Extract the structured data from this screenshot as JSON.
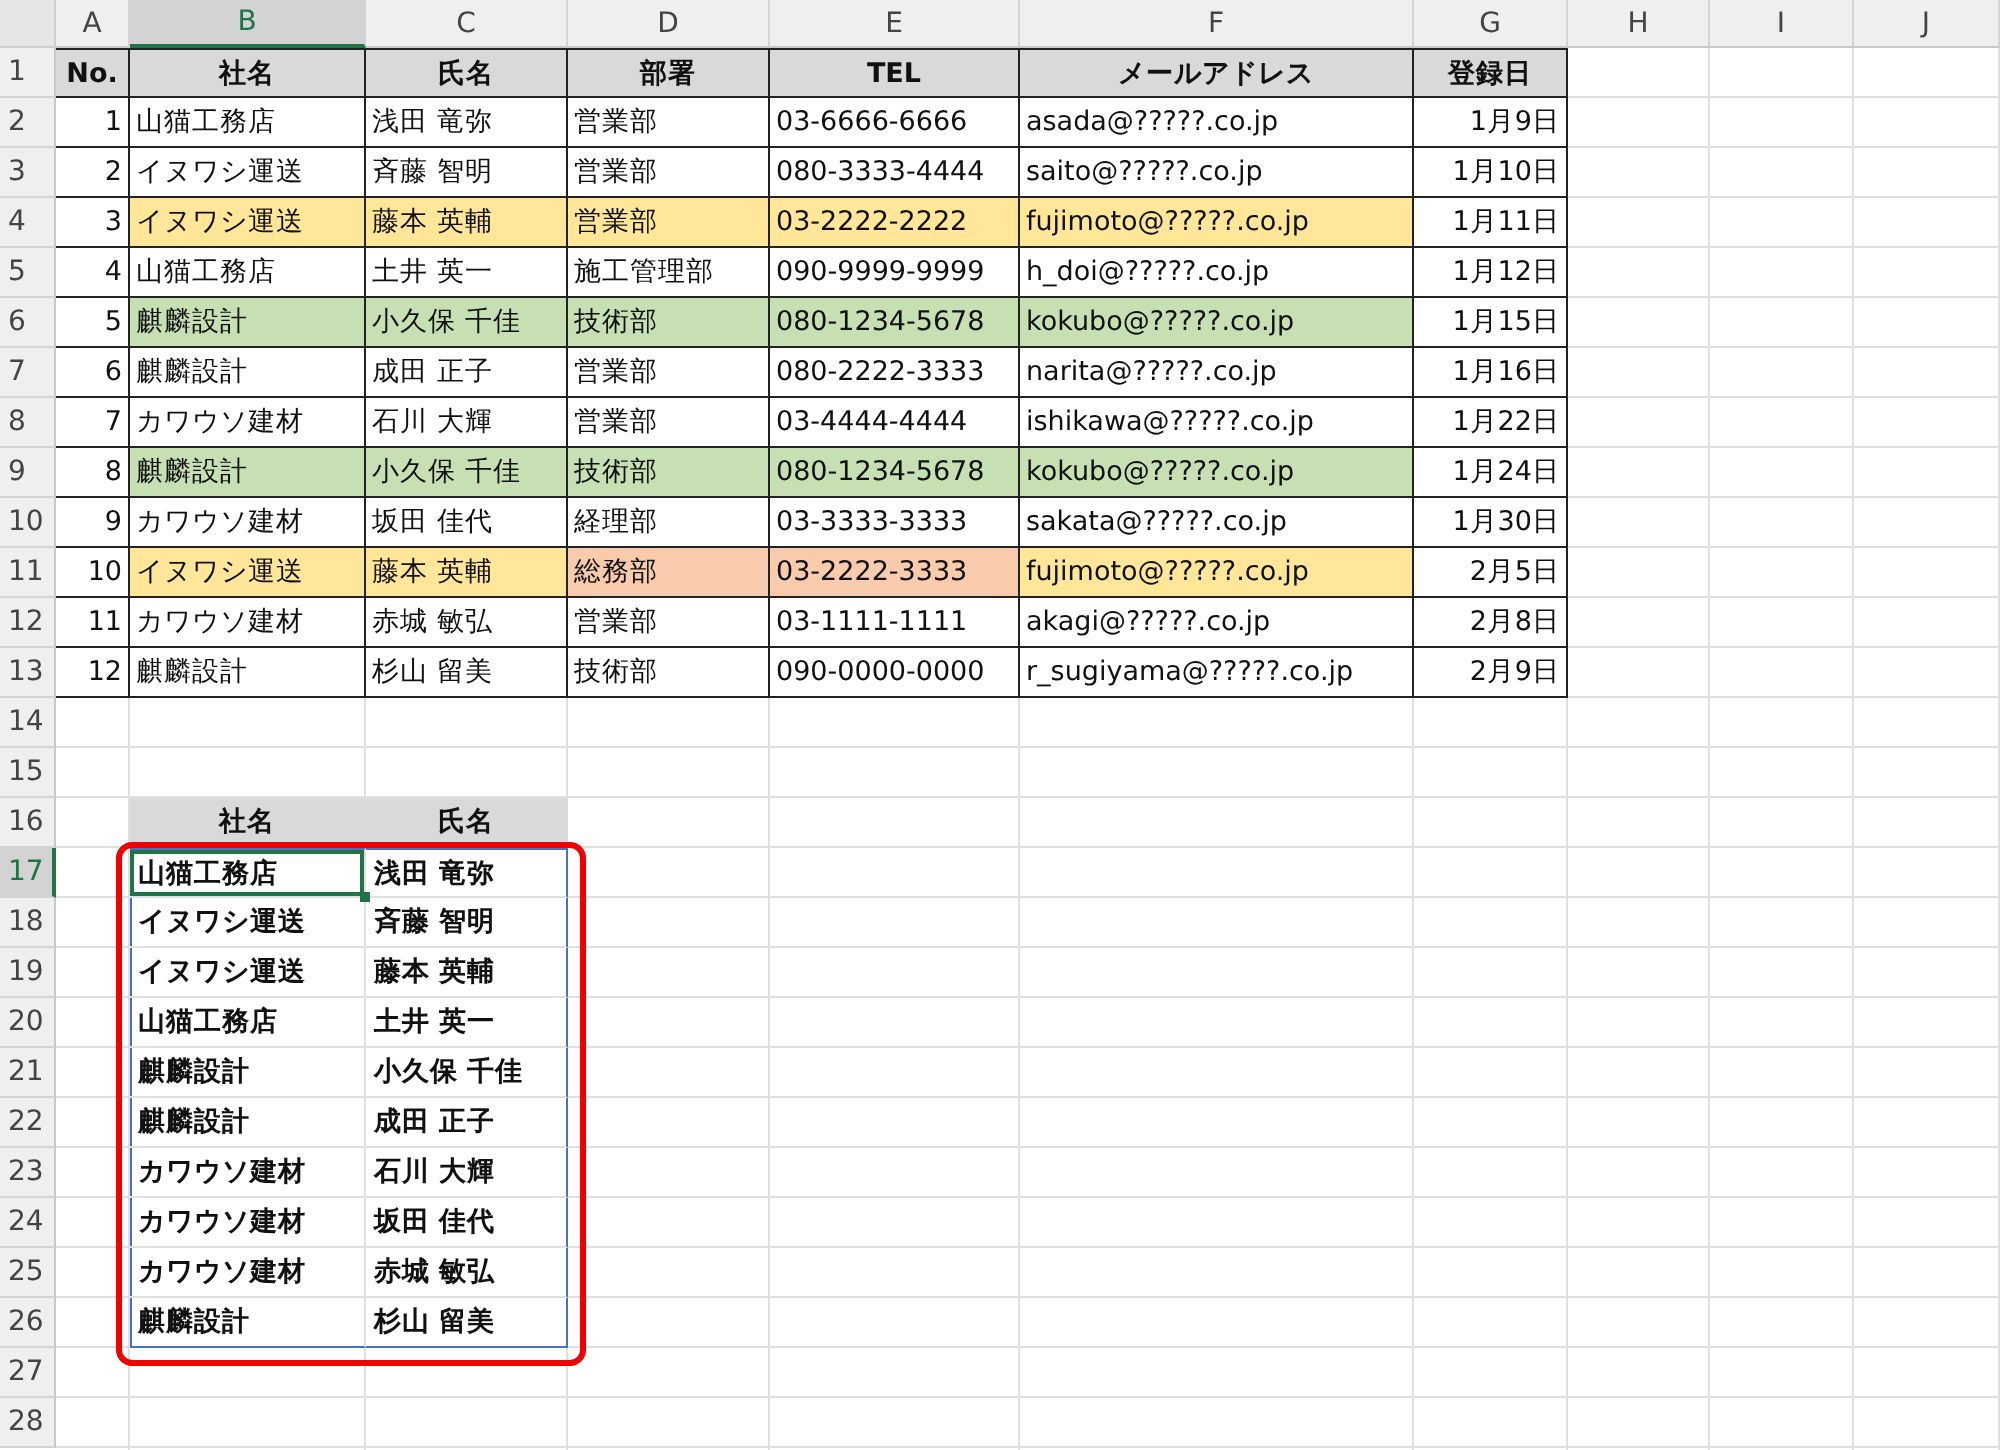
{
  "column_headers": [
    {
      "label": "A",
      "selected": false
    },
    {
      "label": "B",
      "selected": true
    },
    {
      "label": "C",
      "selected": false
    },
    {
      "label": "D",
      "selected": false
    },
    {
      "label": "E",
      "selected": false
    },
    {
      "label": "F",
      "selected": false
    },
    {
      "label": "G",
      "selected": false
    },
    {
      "label": "H",
      "selected": false
    },
    {
      "label": "I",
      "selected": false
    },
    {
      "label": "J",
      "selected": false
    }
  ],
  "row_headers": [
    {
      "label": "1",
      "selected": false
    },
    {
      "label": "2",
      "selected": false
    },
    {
      "label": "3",
      "selected": false
    },
    {
      "label": "4",
      "selected": false
    },
    {
      "label": "5",
      "selected": false
    },
    {
      "label": "6",
      "selected": false
    },
    {
      "label": "7",
      "selected": false
    },
    {
      "label": "8",
      "selected": false
    },
    {
      "label": "9",
      "selected": false
    },
    {
      "label": "10",
      "selected": false
    },
    {
      "label": "11",
      "selected": false
    },
    {
      "label": "12",
      "selected": false
    },
    {
      "label": "13",
      "selected": false
    },
    {
      "label": "14",
      "selected": false
    },
    {
      "label": "15",
      "selected": false
    },
    {
      "label": "16",
      "selected": false
    },
    {
      "label": "17",
      "selected": true
    },
    {
      "label": "18",
      "selected": false
    },
    {
      "label": "19",
      "selected": false
    },
    {
      "label": "20",
      "selected": false
    },
    {
      "label": "21",
      "selected": false
    },
    {
      "label": "22",
      "selected": false
    },
    {
      "label": "23",
      "selected": false
    },
    {
      "label": "24",
      "selected": false
    },
    {
      "label": "25",
      "selected": false
    },
    {
      "label": "26",
      "selected": false
    },
    {
      "label": "27",
      "selected": false
    },
    {
      "label": "28",
      "selected": false
    }
  ],
  "table": {
    "columns": [
      "No.",
      "社名",
      "氏名",
      "部署",
      "TEL",
      "メールアドレス",
      "登録日"
    ],
    "rows": [
      {
        "cells": [
          {
            "text": "1"
          },
          {
            "text": "山猫工務店"
          },
          {
            "text": "浅田 竜弥"
          },
          {
            "text": "営業部"
          },
          {
            "text": "03-6666-6666"
          },
          {
            "text": "asada@?????.co.jp"
          },
          {
            "text": "1月9日"
          }
        ]
      },
      {
        "cells": [
          {
            "text": "2"
          },
          {
            "text": "イヌワシ運送"
          },
          {
            "text": "斉藤 智明"
          },
          {
            "text": "営業部"
          },
          {
            "text": "080-3333-4444"
          },
          {
            "text": "saito@?????.co.jp"
          },
          {
            "text": "1月10日"
          }
        ]
      },
      {
        "cells": [
          {
            "text": "3"
          },
          {
            "text": "イヌワシ運送",
            "color": "#ffe699"
          },
          {
            "text": "藤本 英輔",
            "color": "#ffe699"
          },
          {
            "text": "営業部",
            "color": "#ffe699"
          },
          {
            "text": "03-2222-2222",
            "color": "#ffe699"
          },
          {
            "text": "fujimoto@?????.co.jp",
            "color": "#ffe699"
          },
          {
            "text": "1月11日"
          }
        ]
      },
      {
        "cells": [
          {
            "text": "4"
          },
          {
            "text": "山猫工務店"
          },
          {
            "text": "土井 英一"
          },
          {
            "text": "施工管理部"
          },
          {
            "text": "090-9999-9999"
          },
          {
            "text": "h_doi@?????.co.jp"
          },
          {
            "text": "1月12日"
          }
        ]
      },
      {
        "cells": [
          {
            "text": "5"
          },
          {
            "text": "麒麟設計",
            "color": "#c6e0b4"
          },
          {
            "text": "小久保 千佳",
            "color": "#c6e0b4"
          },
          {
            "text": "技術部",
            "color": "#c6e0b4"
          },
          {
            "text": "080-1234-5678",
            "color": "#c6e0b4"
          },
          {
            "text": "kokubo@?????.co.jp",
            "color": "#c6e0b4"
          },
          {
            "text": "1月15日"
          }
        ]
      },
      {
        "cells": [
          {
            "text": "6"
          },
          {
            "text": "麒麟設計"
          },
          {
            "text": "成田 正子"
          },
          {
            "text": "営業部"
          },
          {
            "text": "080-2222-3333"
          },
          {
            "text": "narita@?????.co.jp"
          },
          {
            "text": "1月16日"
          }
        ]
      },
      {
        "cells": [
          {
            "text": "7"
          },
          {
            "text": "カワウソ建材"
          },
          {
            "text": "石川 大輝"
          },
          {
            "text": "営業部"
          },
          {
            "text": "03-4444-4444"
          },
          {
            "text": "ishikawa@?????.co.jp"
          },
          {
            "text": "1月22日"
          }
        ]
      },
      {
        "cells": [
          {
            "text": "8"
          },
          {
            "text": "麒麟設計",
            "color": "#c6e0b4"
          },
          {
            "text": "小久保 千佳",
            "color": "#c6e0b4"
          },
          {
            "text": "技術部",
            "color": "#c6e0b4"
          },
          {
            "text": "080-1234-5678",
            "color": "#c6e0b4"
          },
          {
            "text": "kokubo@?????.co.jp",
            "color": "#c6e0b4"
          },
          {
            "text": "1月24日"
          }
        ]
      },
      {
        "cells": [
          {
            "text": "9"
          },
          {
            "text": "カワウソ建材"
          },
          {
            "text": "坂田 佳代"
          },
          {
            "text": "経理部"
          },
          {
            "text": "03-3333-3333"
          },
          {
            "text": "sakata@?????.co.jp"
          },
          {
            "text": "1月30日"
          }
        ]
      },
      {
        "cells": [
          {
            "text": "10"
          },
          {
            "text": "イヌワシ運送",
            "color": "#ffe699"
          },
          {
            "text": "藤本 英輔",
            "color": "#ffe699"
          },
          {
            "text": "総務部",
            "color": "#f8cbad"
          },
          {
            "text": "03-2222-3333",
            "color": "#f8cbad"
          },
          {
            "text": "fujimoto@?????.co.jp",
            "color": "#ffe699"
          },
          {
            "text": "2月5日"
          }
        ]
      },
      {
        "cells": [
          {
            "text": "11"
          },
          {
            "text": "カワウソ建材"
          },
          {
            "text": "赤城 敏弘"
          },
          {
            "text": "営業部"
          },
          {
            "text": "03-1111-1111"
          },
          {
            "text": "akagi@?????.co.jp"
          },
          {
            "text": "2月8日"
          }
        ]
      },
      {
        "cells": [
          {
            "text": "12"
          },
          {
            "text": "麒麟設計"
          },
          {
            "text": "杉山 留美"
          },
          {
            "text": "技術部"
          },
          {
            "text": "090-0000-0000"
          },
          {
            "text": "r_sugiyama@?????.co.jp"
          },
          {
            "text": "2月9日"
          }
        ]
      }
    ]
  },
  "extract": {
    "columns": [
      "社名",
      "氏名"
    ],
    "rows": [
      {
        "cells": [
          {
            "text": "山猫工務店",
            "selected": true
          },
          {
            "text": "浅田 竜弥",
            "selected": false
          }
        ]
      },
      {
        "cells": [
          {
            "text": "イヌワシ運送",
            "selected": false
          },
          {
            "text": "斉藤 智明",
            "selected": false
          }
        ]
      },
      {
        "cells": [
          {
            "text": "イヌワシ運送",
            "selected": false
          },
          {
            "text": "藤本 英輔",
            "selected": false
          }
        ]
      },
      {
        "cells": [
          {
            "text": "山猫工務店",
            "selected": false
          },
          {
            "text": "土井 英一",
            "selected": false
          }
        ]
      },
      {
        "cells": [
          {
            "text": "麒麟設計",
            "selected": false
          },
          {
            "text": "小久保 千佳",
            "selected": false
          }
        ]
      },
      {
        "cells": [
          {
            "text": "麒麟設計",
            "selected": false
          },
          {
            "text": "成田 正子",
            "selected": false
          }
        ]
      },
      {
        "cells": [
          {
            "text": "カワウソ建材",
            "selected": false
          },
          {
            "text": "石川 大輝",
            "selected": false
          }
        ]
      },
      {
        "cells": [
          {
            "text": "カワウソ建材",
            "selected": false
          },
          {
            "text": "坂田 佳代",
            "selected": false
          }
        ]
      },
      {
        "cells": [
          {
            "text": "カワウソ建材",
            "selected": false
          },
          {
            "text": "赤城 敏弘",
            "selected": false
          }
        ]
      },
      {
        "cells": [
          {
            "text": "麒麟設計",
            "selected": false
          },
          {
            "text": "杉山 留美",
            "selected": false
          }
        ]
      }
    ]
  }
}
